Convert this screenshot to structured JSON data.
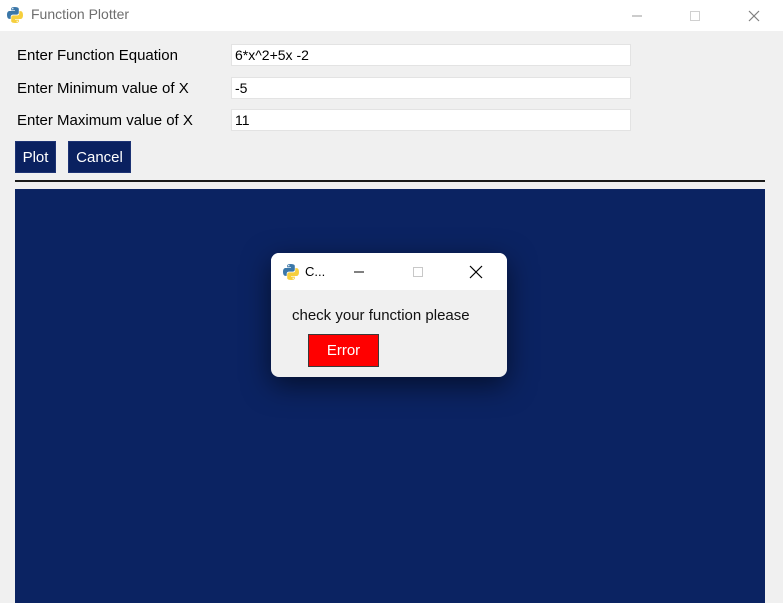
{
  "window": {
    "title": "Function Plotter",
    "icon": "python-icon",
    "controls": [
      "minimize-icon",
      "maximize-icon",
      "close-icon"
    ]
  },
  "form": {
    "equation_label": "Enter Function Equation",
    "equation_value": "6*x^2+5x -2",
    "min_label": "Enter Minimum value of X",
    "min_value": "-5",
    "max_label": "Enter Maximum value of X",
    "max_value": "11"
  },
  "buttons": {
    "plot_label": "Plot",
    "cancel_label": "Cancel"
  },
  "dialog": {
    "title": "C...",
    "message": "check your function please",
    "button_label": "Error",
    "button_color": "#ff0000"
  },
  "colors": {
    "canvas": "#0b2362",
    "button": "#0a2160"
  }
}
